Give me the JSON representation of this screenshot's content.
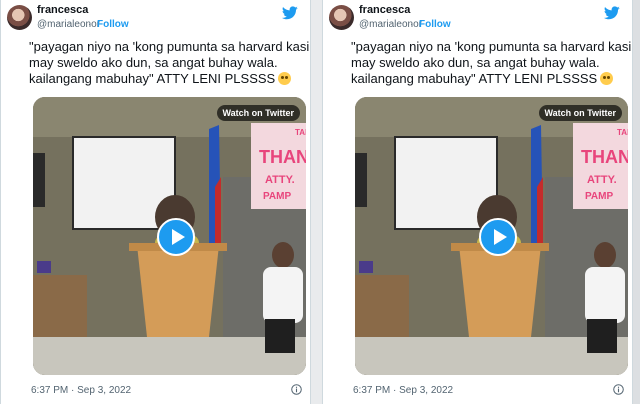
{
  "tweets": [
    {
      "author": {
        "name": "francesca",
        "handle": "@marialeonor",
        "separator": "·",
        "follow_label": "Follow"
      },
      "text_lines": [
        "\"payagan niyo na 'kong pumunta sa harvard kasi",
        "may sweldo ako dun, sa angat buhay wala.",
        "kailangang mabuhay\" ATTY LENI PLSSSS"
      ],
      "media": {
        "watch_label": "Watch on Twitter",
        "banner_text": {
          "line1": "THAN",
          "line2": "ATTY.",
          "line3": "PAMP",
          "corner": "TAN"
        }
      },
      "timestamp": "6:37 PM · Sep 3, 2022"
    },
    {
      "author": {
        "name": "francesca",
        "handle": "@marialeonor",
        "separator": "·",
        "follow_label": "Follow"
      },
      "text_lines": [
        "\"payagan niyo na 'kong pumunta sa harvard kasi",
        "may sweldo ako dun, sa angat buhay wala.",
        "kailangang mabuhay\" ATTY LENI PLSSSS"
      ],
      "media": {
        "watch_label": "Watch on Twitter",
        "banner_text": {
          "line1": "THAN",
          "line2": "ATTY.",
          "line3": "PAMP",
          "corner": "TAN"
        }
      },
      "timestamp": "6:37 PM · Sep 3, 2022"
    }
  ],
  "icons": {
    "logo": "twitter-bird-icon",
    "emoji": "loudly-crying-face-icon",
    "play": "play-icon",
    "info": "info-icon"
  },
  "colors": {
    "accent": "#1d9bf0",
    "text": "#0f1419",
    "muted": "#536471",
    "border": "#cfd9de",
    "banner_text": "#e8457c"
  }
}
